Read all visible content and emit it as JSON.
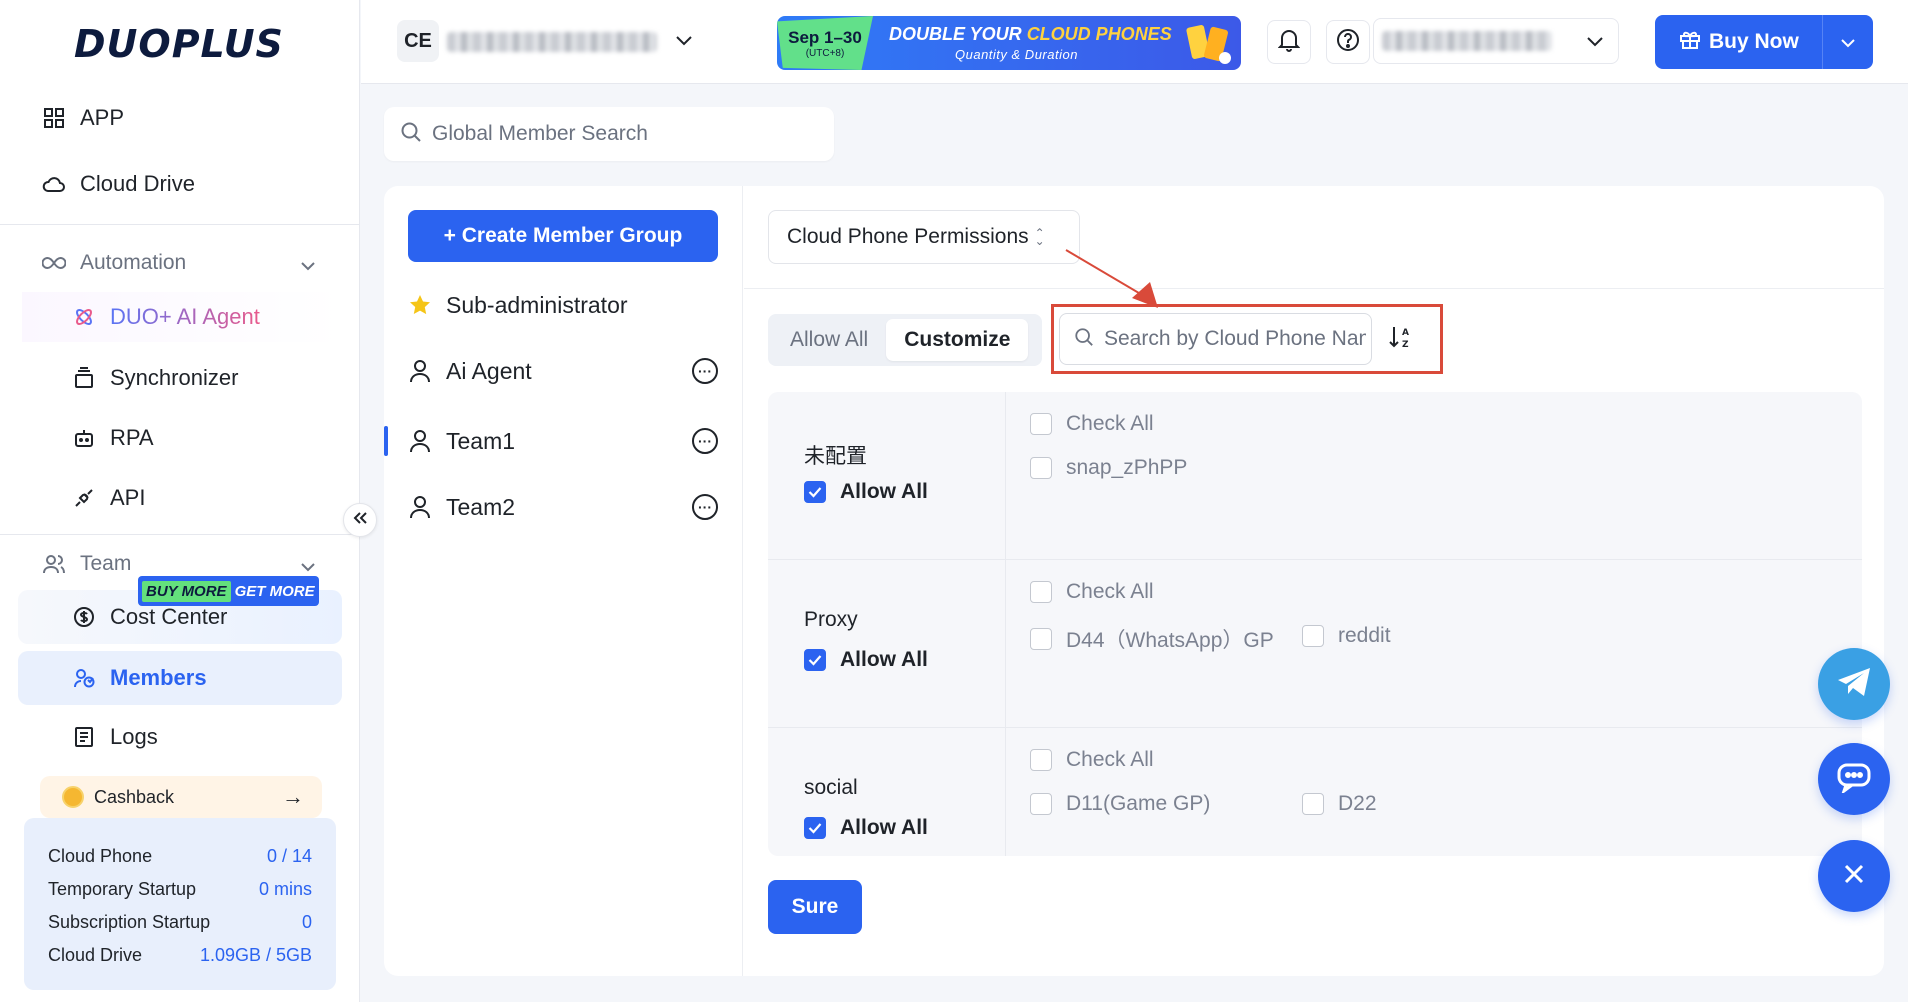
{
  "brand": {
    "logo": "DUOPLUS"
  },
  "sidebar": {
    "app": "APP",
    "cloud_drive": "Cloud Drive",
    "automation": "Automation",
    "ai_agent": "DUO+ AI Agent",
    "synchronizer": "Synchronizer",
    "rpa": "RPA",
    "api": "API",
    "team": "Team",
    "cost_center": "Cost Center",
    "buy_more": "BUY MORE",
    "get_more": "GET MORE",
    "members": "Members",
    "logs": "Logs",
    "cashback": "Cashback",
    "quota": [
      {
        "label": "Cloud Phone",
        "value": "0 / 14"
      },
      {
        "label": "Temporary Startup",
        "value": "0 mins"
      },
      {
        "label": "Subscription Startup",
        "value": "0"
      },
      {
        "label": "Cloud Drive",
        "value": "1.09GB / 5GB"
      }
    ]
  },
  "header": {
    "workspace_initials": "CE",
    "banner": {
      "date": "Sep 1–30",
      "timezone": "(UTC+8)",
      "title_a": "DOUBLE YOUR ",
      "title_b": "CLOUD PHONES",
      "subtitle": "Quantity & Duration"
    },
    "buy_now": "Buy Now"
  },
  "search": {
    "placeholder": "Global Member Search"
  },
  "groups": {
    "create_button": "+ Create Member Group",
    "items": [
      "Sub-administrator",
      "Ai Agent",
      "Team1",
      "Team2"
    ]
  },
  "permissions": {
    "type_select": "Cloud Phone Permissions",
    "mode_options": [
      "Allow All",
      "Customize"
    ],
    "active_mode": "Customize",
    "search_placeholder": "Search by Cloud Phone Name",
    "check_all": "Check All",
    "allow_all": "Allow All",
    "groups": [
      {
        "name": "未配置",
        "allow_all": true,
        "phones": [
          "snap_zPhPP"
        ]
      },
      {
        "name": "Proxy",
        "allow_all": true,
        "phones": [
          "D44（WhatsApp）GP",
          "reddit"
        ]
      },
      {
        "name": "social",
        "allow_all": true,
        "phones": [
          "D11(Game GP)",
          "D22"
        ]
      }
    ],
    "submit": "Sure"
  },
  "colors": {
    "accent": "#2b63f0",
    "highlight": "#d94a3a"
  }
}
